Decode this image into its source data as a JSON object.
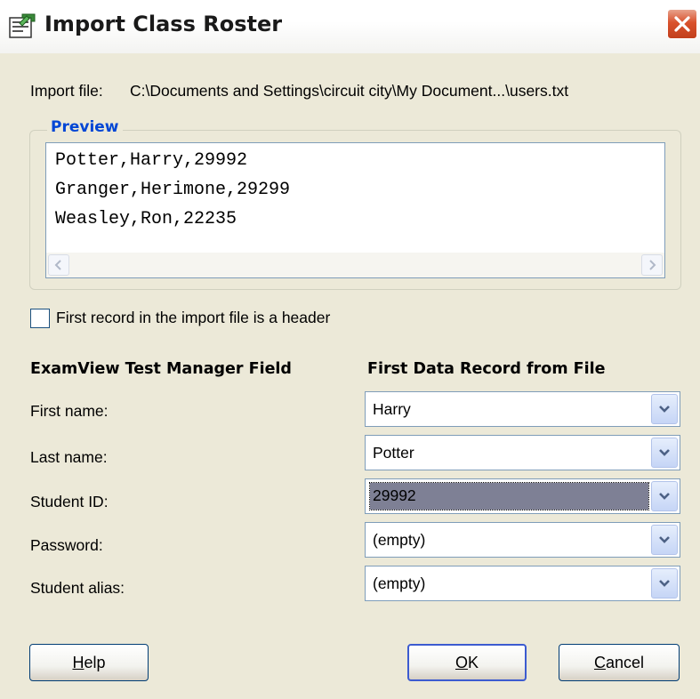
{
  "window": {
    "title": "Import Class Roster",
    "icon": "import-roster-icon",
    "close_icon": "close-icon"
  },
  "import_file": {
    "label": "Import file:",
    "path": "C:\\Documents and Settings\\circuit city\\My Document...\\users.txt"
  },
  "preview": {
    "legend": "Preview",
    "lines": [
      "Potter,Harry,29992",
      "Granger,Herimone,29299",
      "Weasley,Ron,22235"
    ]
  },
  "header_checkbox": {
    "label": "First record in the import file is a header",
    "checked": false
  },
  "mapping": {
    "left_header": "ExamView Test Manager Field",
    "right_header": "First Data Record from File",
    "rows": [
      {
        "field": "First name:",
        "value": "Harry"
      },
      {
        "field": "Last name:",
        "value": "Potter"
      },
      {
        "field": "Student ID:",
        "value": "29992"
      },
      {
        "field": "Password:",
        "value": "(empty)"
      },
      {
        "field": "Student alias:",
        "value": "(empty)"
      }
    ]
  },
  "buttons": {
    "help": {
      "first": "H",
      "rest": "elp"
    },
    "ok": {
      "first": "O",
      "rest": "K"
    },
    "cancel": {
      "first": "C",
      "rest": "ancel"
    }
  },
  "colors": {
    "dialog_bg": "#ece9d8",
    "accent_blue": "#0046d5",
    "close_red": "#d9512c",
    "selection": "#7e8095"
  }
}
